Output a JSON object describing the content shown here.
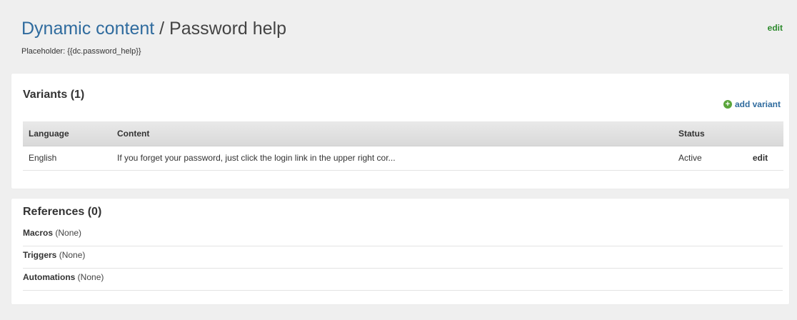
{
  "header": {
    "crumb": "Dynamic content",
    "separator": " / ",
    "title": "Password help",
    "edit_label": "edit",
    "placeholder_text": "Placeholder: {{dc.password_help}}"
  },
  "variants": {
    "title": "Variants (1)",
    "add_label": "add variant",
    "columns": [
      "Language",
      "Content",
      "Status",
      ""
    ],
    "rows": [
      {
        "language": "English",
        "content": "If you forget your password, just click the login link in the upper right cor...",
        "status": "Active",
        "action": "edit"
      }
    ]
  },
  "references": {
    "title": "References (0)",
    "items": [
      {
        "name": "Macros",
        "value": " (None)"
      },
      {
        "name": "Triggers",
        "value": " (None)"
      },
      {
        "name": "Automations",
        "value": " (None)"
      }
    ]
  },
  "colors": {
    "link_blue": "#2f6b9e",
    "edit_green": "#2c8a2c",
    "add_icon_green": "#5aa53b",
    "background": "#efefef"
  }
}
